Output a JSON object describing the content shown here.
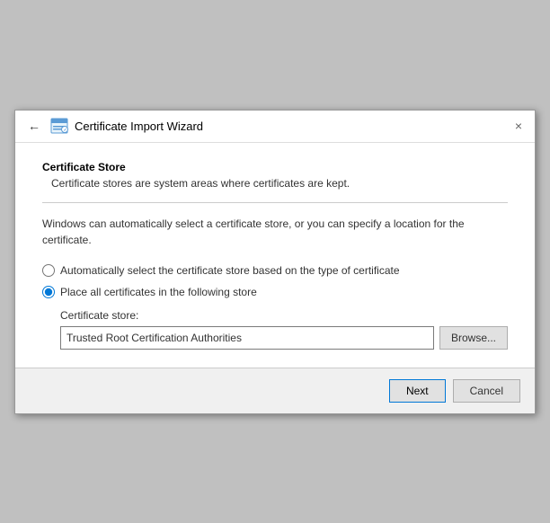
{
  "window": {
    "title": "Certificate Import Wizard",
    "close_label": "×",
    "back_arrow": "←"
  },
  "section": {
    "title": "Certificate Store",
    "description": "Certificate stores are system areas where certificates are kept."
  },
  "body": {
    "info_text": "Windows can automatically select a certificate store, or you can specify a location for the certificate.",
    "radio_auto_label": "Automatically select the certificate store based on the type of certificate",
    "radio_manual_label": "Place all certificates in the following store",
    "cert_store_label": "Certificate store:",
    "cert_store_value": "Trusted Root Certification Authorities",
    "browse_label": "Browse..."
  },
  "footer": {
    "next_label": "Next",
    "cancel_label": "Cancel"
  }
}
